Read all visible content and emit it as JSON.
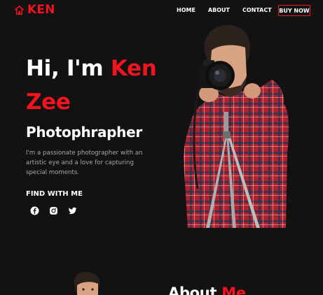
{
  "brand": {
    "name": "KEN",
    "icon": "house-icon",
    "color": "#f0141e"
  },
  "nav": {
    "links": [
      "HOME",
      "ABOUT",
      "CONTACT"
    ],
    "cta": "BUY NOW"
  },
  "hero": {
    "greeting": "Hi, I'm ",
    "name_first": "Ken",
    "name_last": "Zee",
    "subtitle": "Photophrapher",
    "description": "I'm a passionate photographer with an artistic eye and a love for capturing special moments.",
    "find_title": "FIND WITH ME",
    "socials": [
      {
        "name": "facebook",
        "icon": "facebook-icon"
      },
      {
        "name": "instagram",
        "icon": "instagram-icon"
      },
      {
        "name": "twitter",
        "icon": "twitter-icon"
      }
    ]
  },
  "about": {
    "title_part1": "About ",
    "title_part2": "Me"
  },
  "colors": {
    "background": "#121213",
    "accent": "#f0141e",
    "text": "#ffffff",
    "muted": "#a8a8a8"
  }
}
